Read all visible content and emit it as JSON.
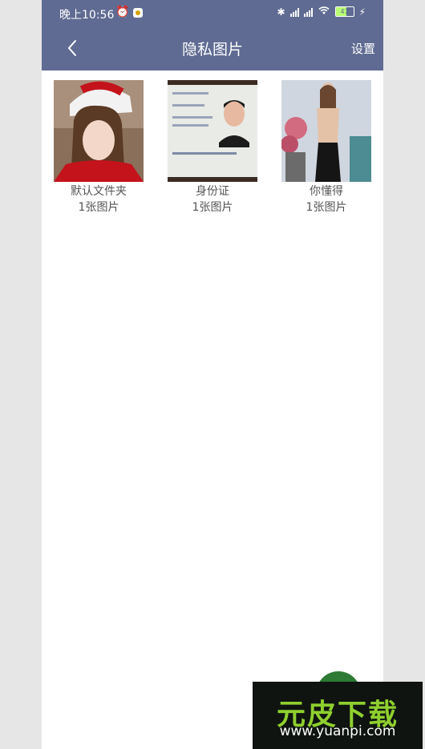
{
  "status": {
    "time": "晚上10:56",
    "battery": "47"
  },
  "header": {
    "title": "隐私图片",
    "settings_label": "设置"
  },
  "folders": [
    {
      "name": "默认文件夹",
      "count": "1张图片"
    },
    {
      "name": "身份证",
      "count": "1张图片"
    },
    {
      "name": "你懂得",
      "count": "1张图片"
    }
  ],
  "watermark": {
    "logo": "元皮下载",
    "url": "www.yuanpi.com"
  }
}
